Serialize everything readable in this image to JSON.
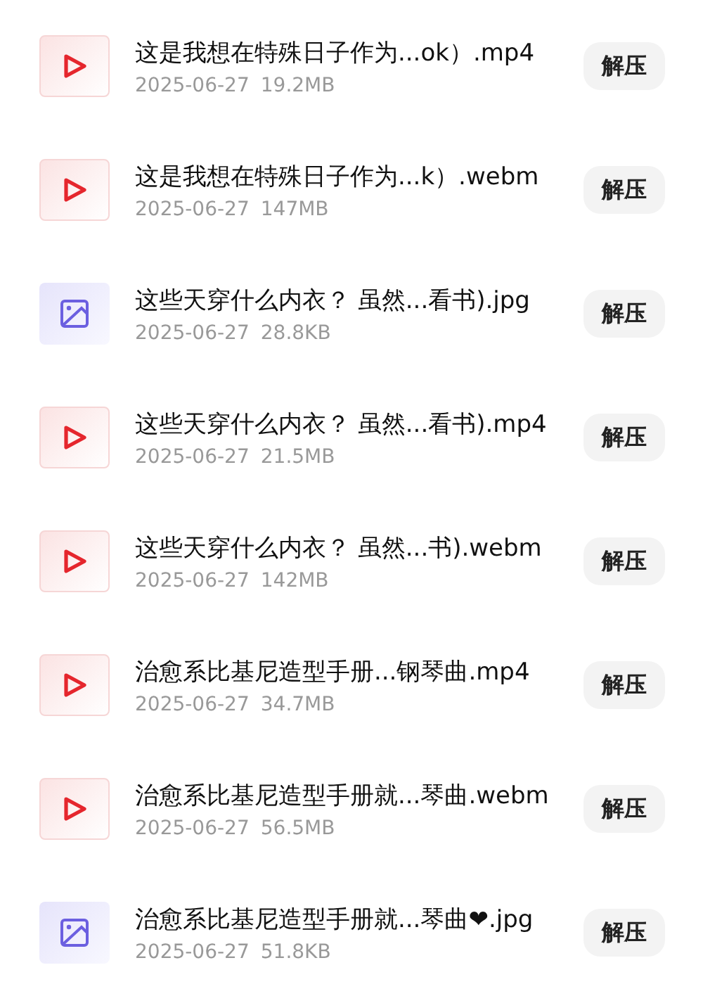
{
  "files": [
    {
      "kind": "video",
      "name": "这是我想在特殊日子作为...ok）.mp4",
      "date": "2025-06-27",
      "size": "19.2MB",
      "action": "解压"
    },
    {
      "kind": "video",
      "name": "这是我想在特殊日子作为...k）.webm",
      "date": "2025-06-27",
      "size": "147MB",
      "action": "解压"
    },
    {
      "kind": "image",
      "name": "这些天穿什么内衣？ 虽然...看书).jpg",
      "date": "2025-06-27",
      "size": "28.8KB",
      "action": "解压"
    },
    {
      "kind": "video",
      "name": "这些天穿什么内衣？ 虽然...看书).mp4",
      "date": "2025-06-27",
      "size": "21.5MB",
      "action": "解压"
    },
    {
      "kind": "video",
      "name": "这些天穿什么内衣？ 虽然...书).webm",
      "date": "2025-06-27",
      "size": "142MB",
      "action": "解压"
    },
    {
      "kind": "video",
      "name": "治愈系比基尼造型手册...钢琴曲.mp4",
      "date": "2025-06-27",
      "size": "34.7MB",
      "action": "解压"
    },
    {
      "kind": "video",
      "name": "治愈系比基尼造型手册就...琴曲.webm",
      "date": "2025-06-27",
      "size": "56.5MB",
      "action": "解压"
    },
    {
      "kind": "image",
      "name": "治愈系比基尼造型手册就...琴曲❤.jpg",
      "date": "2025-06-27",
      "size": "51.8KB",
      "action": "解压"
    }
  ]
}
